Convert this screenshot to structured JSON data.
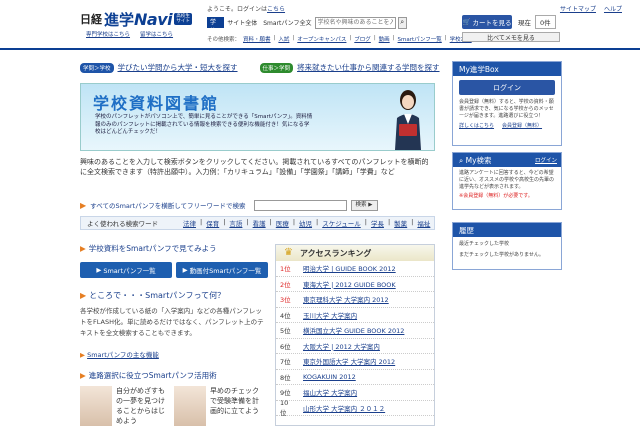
{
  "header": {
    "logo_nikkei": "日経",
    "logo_shingaku": "進学",
    "logo_navi": "Navi",
    "logo_badge": "高校生サイト",
    "sublinks": [
      "専門学校はこちら",
      "留学はこちら"
    ],
    "welcome": "ようこそ。ログインは",
    "welcome_link": "こちら",
    "top_links": [
      "サイトマップ",
      "ヘルプ"
    ],
    "search_school_label": "学校名",
    "search_site_label": "サイト全体　Smartパンフ全文",
    "search_placeholder": "学校名や興味のあることを入力",
    "search_icon": "magnifier-icon",
    "other_links_label": "その他検索：",
    "other_links": [
      "資料・願書",
      "入試",
      "オープンキャンパス",
      "ブログ",
      "動画",
      "Smartパンフ一覧",
      "学校から"
    ],
    "cart_label": "カートを見る",
    "cart_info_label": "現在",
    "cart_count": "0件",
    "memo_label": "比べてメモを見る"
  },
  "links": {
    "tag1": "学問＞学校",
    "link1": "学びたい学問から大学・短大を探す",
    "tag2": "仕事＞学問",
    "link2": "将来就きたい仕事から関連する学問を探す"
  },
  "banner": {
    "title": "学校資料図書館",
    "body": "学校のパンフレットがパソコン上で、簡単に見ることができる「Smartパンフ」。資料情報のみのパンフレットに掲載されている情報を検索できる便利な機能付き！気になる学校はどんどんチェックだ！"
  },
  "description": "興味のあることを入力して検索ボタンをクリックしてください。掲載されているすべてのパンフレットを横断的に全文検索できます（特許出願中）。入力例：「カリキュラム」「設備」「学園祭」「講師」「学費」など",
  "smart_search": {
    "label1": "すべてのSmartパンフを横断してフリーワードで検索",
    "button": "検索 ▶"
  },
  "keywords": {
    "header": "よく使われる検索ワード",
    "items": [
      "法律",
      "保育",
      "言語",
      "看護",
      "医療",
      "幼児",
      "スケジュール",
      "学長",
      "製薬",
      "福祉"
    ]
  },
  "section1": {
    "title": "学校資料をSmartパンフで見てみよう",
    "btn1": "Smartパンフ一覧",
    "btn2": "動画付Smartパンフ一覧"
  },
  "section2": {
    "title": "ところで・・・Smartパンフって何？",
    "body": "各学校が作成している紙の「入学案内」などの各種パンフレットをFLASH化。単に読めるだけではなく、パンフレット上のテキストを全文検索することもできます。",
    "link": "Smartパンフの主な機能"
  },
  "section3": {
    "title": "進路選択に役立つSmartパンフ活用術",
    "thumbs": [
      {
        "text": "自分がめざすもの一夢を見つけることからはじめよう"
      },
      {
        "text": "早めのチェックで受験準備を計画的に立てよう"
      }
    ]
  },
  "ranking": {
    "title": "アクセスランキング",
    "items": [
      {
        "rank": "1位",
        "name": "明治大学 | GUIDE BOOK 2012"
      },
      {
        "rank": "2位",
        "name": "東海大学 | 2012 GUIDE BOOK"
      },
      {
        "rank": "3位",
        "name": "東京理科大学 大学案内 2012"
      },
      {
        "rank": "4位",
        "name": "玉川大学 大学案内"
      },
      {
        "rank": "5位",
        "name": "横浜国立大学 GUIDE BOOK 2012"
      },
      {
        "rank": "6位",
        "name": "大阪大学 | 2012 大学案内"
      },
      {
        "rank": "7位",
        "name": "東京外国語大学 大学案内 2012"
      },
      {
        "rank": "8位",
        "name": "KOGAKUIN 2012"
      },
      {
        "rank": "9位",
        "name": "福山大学 大学案内"
      },
      {
        "rank": "10位",
        "name": "山形大学 大学案内 ２０１２"
      }
    ]
  },
  "sidebar": {
    "box1_title": "My進学Box",
    "login": "ログイン",
    "box1_desc": "会員登録（無料）すると、学校の資料・願書が請求でき、気になる学校からのメッセージが届きます。進路選びに役立つ！",
    "box1_links": [
      "詳しくはこちら",
      "会員登録（無料）"
    ],
    "box2_title": "My検索",
    "box2_login": "ログイン",
    "box2_desc": "進路アンケートに回答すると、今どの希望に近い、オススメの学校や高校生の先輩の進学先などが表示されます。",
    "box2_warn": "※会員登録（無料）が必要です。",
    "box3_title": "履歴",
    "box3_items": [
      "最近チェックした学校",
      "まだチェックした学校がありません。"
    ]
  }
}
